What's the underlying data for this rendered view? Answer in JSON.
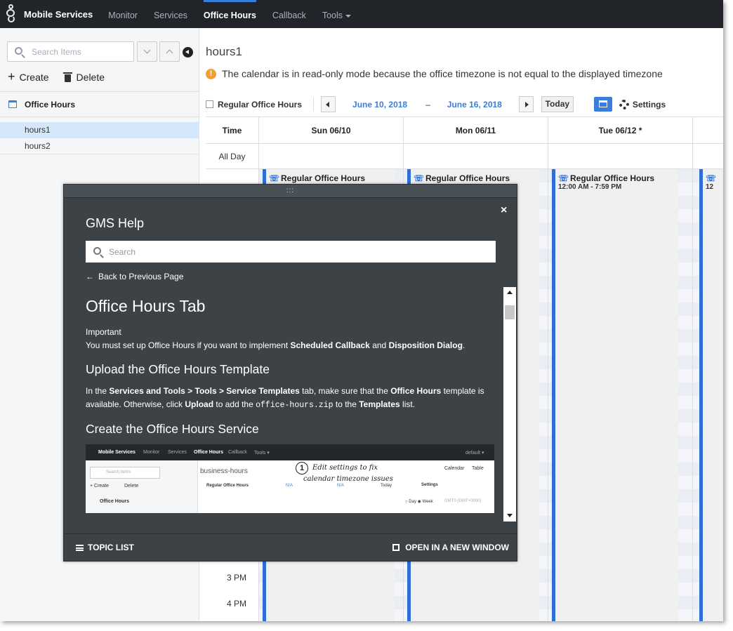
{
  "nav": {
    "brand": "Mobile Services",
    "items": [
      {
        "label": "Monitor",
        "active": false
      },
      {
        "label": "Services",
        "active": false
      },
      {
        "label": "Office Hours",
        "active": true
      },
      {
        "label": "Callback",
        "active": false
      },
      {
        "label": "Tools",
        "active": false
      }
    ],
    "logo_icon": "genesys-logo-icon"
  },
  "sidebar": {
    "search_placeholder": "Search Items",
    "create_label": "Create",
    "delete_label": "Delete",
    "section_label": "Office Hours",
    "items": [
      {
        "label": "hours1",
        "selected": true
      },
      {
        "label": "hours2",
        "selected": false
      }
    ]
  },
  "main": {
    "title": "hours1",
    "warning": "The calendar is in read-only mode because the office timezone is not equal to the displayed timezone",
    "toolbar": {
      "checkbox_label": "Regular Office Hours",
      "start_date": "June 10, 2018",
      "separator": "–",
      "end_date": "June 16, 2018",
      "today_label": "Today",
      "settings_label": "Settings"
    },
    "calendar": {
      "time_header": "Time",
      "all_day_label": "All Day",
      "days": [
        "Sun 06/10",
        "Mon 06/11",
        "Tue 06/12 *"
      ],
      "event_title": "Regular Office Hours",
      "event_time": "12:00 AM - 7:59 PM",
      "event_time_partial": "12",
      "time_labels": [
        "3 PM",
        "4 PM"
      ],
      "accent_color": "#2d6fd6"
    }
  },
  "help": {
    "grip": ":::",
    "close": "×",
    "title": "GMS Help",
    "search_placeholder": "Search",
    "back_label": "Back to Previous Page",
    "h1": "Office Hours Tab",
    "important_label": "Important",
    "important_text_1": "You must set up Office Hours if you want to implement ",
    "important_bold_1": "Scheduled Callback",
    "important_text_2": " and ",
    "important_bold_2": "Disposition Dialog",
    "important_text_3": ".",
    "h2_upload": "Upload the Office Hours Template",
    "upload_text": {
      "t1": "In the ",
      "b1": "Services and Tools > Tools > Service Templates",
      "t2": " tab, make sure that the ",
      "b2": "Office Hours",
      "t3": " template is available. Otherwise, click ",
      "b3": "Upload",
      "t4": " to add the ",
      "code": "office-hours.zip",
      "t5": " to the ",
      "b4": "Templates",
      "t6": " list."
    },
    "h2_create": "Create the Office Hours Service",
    "mini": {
      "brand": "Mobile Services",
      "nav": [
        "Monitor",
        "Services",
        "Office Hours",
        "Callback",
        "Tools ▾"
      ],
      "default_label": "default ▾",
      "search": "Search Items",
      "create": "+ Create",
      "delete": "Delete",
      "section": "Office Hours",
      "title": "business-hours",
      "checkbox": "Regular Office Hours",
      "na1": "N/A",
      "na2": "N/A",
      "today": "Today",
      "settings": "Settings",
      "tab_calendar": "Calendar",
      "tab_table": "Table",
      "day_week": "○ Day ◉ Week",
      "tz": "GMT0 (GMT+0000)",
      "annotation_num": "1",
      "annotation_line1": "Edit settings to fix",
      "annotation_line2": "calendar timezone issues"
    },
    "footer_topic_list": "TOPIC LIST",
    "footer_open_window": "OPEN IN A NEW WINDOW"
  }
}
